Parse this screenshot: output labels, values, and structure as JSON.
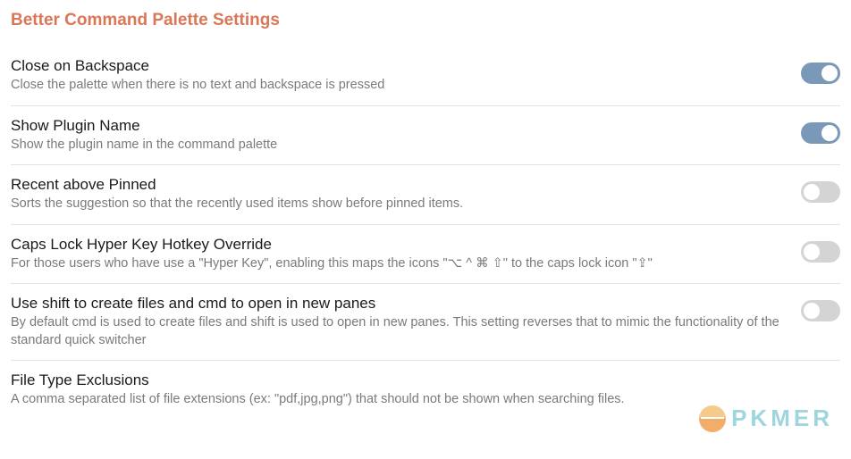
{
  "title": "Better Command Palette Settings",
  "settings": [
    {
      "title": "Close on Backspace",
      "desc": "Close the palette when there is no text and backspace is pressed",
      "toggle": true,
      "on": true
    },
    {
      "title": "Show Plugin Name",
      "desc": "Show the plugin name in the command palette",
      "toggle": true,
      "on": true
    },
    {
      "title": "Recent above Pinned",
      "desc": "Sorts the suggestion so that the recently used items show before pinned items.",
      "toggle": true,
      "on": false
    },
    {
      "title": "Caps Lock Hyper Key Hotkey Override",
      "desc": "For those users who have use a \"Hyper Key\", enabling this maps the icons \"⌥ ^ ⌘ ⇧\" to the caps lock icon \"⇪\"",
      "toggle": true,
      "on": false
    },
    {
      "title": "Use shift to create files and cmd to open in new panes",
      "desc": "By default cmd is used to create files and shift is used to open in new panes. This setting reverses that to mimic the functionality of the standard quick switcher",
      "toggle": true,
      "on": false
    },
    {
      "title": "File Type Exclusions",
      "desc": "A comma separated list of file extensions (ex: \"pdf,jpg,png\") that should not be shown when searching files.",
      "toggle": false,
      "on": false
    }
  ],
  "watermark": "PKMER"
}
